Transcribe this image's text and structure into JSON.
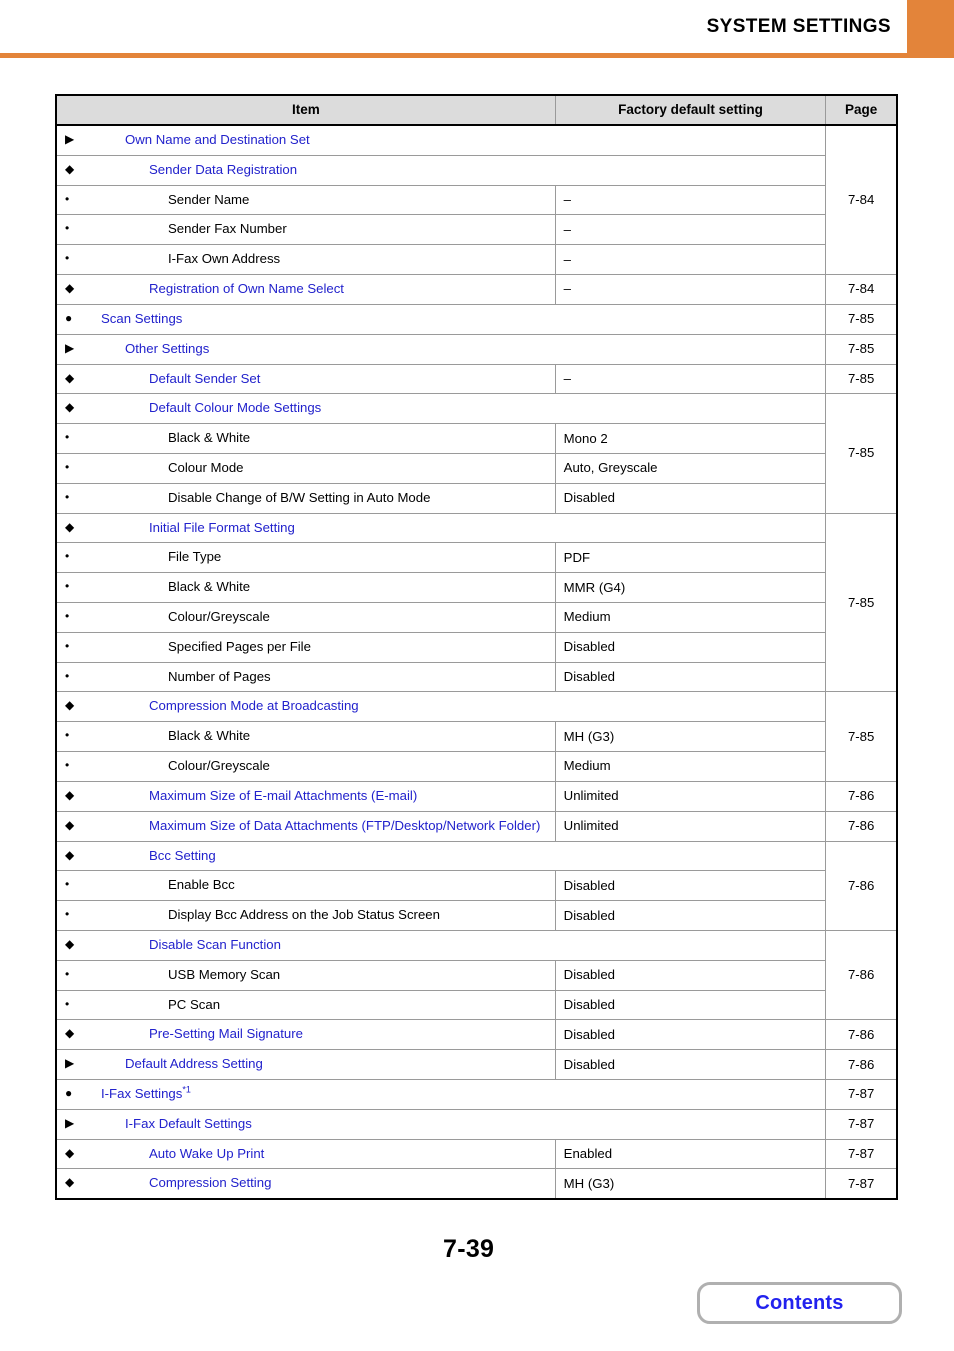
{
  "header": {
    "title": "SYSTEM SETTINGS",
    "accent_color": "#e3843a"
  },
  "table": {
    "columns": {
      "item": "Item",
      "factory_default": "Factory default setting",
      "page": "Page"
    },
    "link_color": "#2222cc",
    "rows": [
      {
        "level": 1,
        "bullet": "triangle",
        "label": "Own Name and Destination Set",
        "style": "link",
        "spans_default": true,
        "default": "",
        "page": "7-84",
        "page_rowspan": 5
      },
      {
        "level": 2,
        "bullet": "diamond",
        "label": "Sender Data Registration",
        "style": "link",
        "spans_default": true,
        "default": ""
      },
      {
        "level": 3,
        "bullet": "dot",
        "label": "Sender Name",
        "style": "plain",
        "default": "–"
      },
      {
        "level": 3,
        "bullet": "dot",
        "label": "Sender Fax Number",
        "style": "plain",
        "default": "–"
      },
      {
        "level": 3,
        "bullet": "dot",
        "label": "I-Fax Own Address",
        "style": "plain",
        "default": "–"
      },
      {
        "level": 2,
        "bullet": "diamond",
        "label": "Registration of Own Name Select",
        "style": "link",
        "default": "–",
        "page": "7-84",
        "page_rowspan": 1
      },
      {
        "level": 0,
        "bullet": "circle",
        "label": "Scan Settings",
        "style": "link",
        "spans_default": true,
        "default": "",
        "page": "7-85",
        "page_rowspan": 1
      },
      {
        "level": 1,
        "bullet": "triangle",
        "label": "Other Settings",
        "style": "link",
        "spans_default": true,
        "default": "",
        "page": "7-85",
        "page_rowspan": 1
      },
      {
        "level": 2,
        "bullet": "diamond",
        "label": "Default Sender Set",
        "style": "link",
        "default": "–",
        "page": "7-85",
        "page_rowspan": 1
      },
      {
        "level": 2,
        "bullet": "diamond",
        "label": "Default Colour Mode Settings",
        "style": "link",
        "spans_default": true,
        "default": "",
        "page": "7-85",
        "page_rowspan": 4
      },
      {
        "level": 3,
        "bullet": "dot",
        "label": "Black & White",
        "style": "plain",
        "default": "Mono 2"
      },
      {
        "level": 3,
        "bullet": "dot",
        "label": "Colour Mode",
        "style": "plain",
        "default": "Auto, Greyscale"
      },
      {
        "level": 3,
        "bullet": "dot",
        "label": "Disable Change of B/W Setting in Auto Mode",
        "style": "plain",
        "default": "Disabled"
      },
      {
        "level": 2,
        "bullet": "diamond",
        "label": "Initial File Format Setting",
        "style": "link",
        "spans_default": true,
        "default": "",
        "page": "7-85",
        "page_rowspan": 6
      },
      {
        "level": 3,
        "bullet": "dot",
        "label": "File Type",
        "style": "plain",
        "default": "PDF"
      },
      {
        "level": 3,
        "bullet": "dot",
        "label": "Black & White",
        "style": "plain",
        "default": "MMR (G4)"
      },
      {
        "level": 3,
        "bullet": "dot",
        "label": "Colour/Greyscale",
        "style": "plain",
        "default": "Medium"
      },
      {
        "level": 3,
        "bullet": "dot",
        "label": "Specified Pages per File",
        "style": "plain",
        "default": "Disabled"
      },
      {
        "level": 3,
        "bullet": "dot",
        "label": "Number of Pages",
        "style": "plain",
        "default": "Disabled"
      },
      {
        "level": 2,
        "bullet": "diamond",
        "label": "Compression Mode at Broadcasting",
        "style": "link",
        "spans_default": true,
        "default": "",
        "page": "7-85",
        "page_rowspan": 3
      },
      {
        "level": 3,
        "bullet": "dot",
        "label": "Black & White",
        "style": "plain",
        "default": "MH (G3)"
      },
      {
        "level": 3,
        "bullet": "dot",
        "label": "Colour/Greyscale",
        "style": "plain",
        "default": "Medium"
      },
      {
        "level": 2,
        "bullet": "diamond",
        "label": "Maximum Size of E-mail Attachments (E-mail)",
        "style": "link",
        "default": "Unlimited",
        "page": "7-86",
        "page_rowspan": 1
      },
      {
        "level": 2,
        "bullet": "diamond",
        "label": "Maximum Size of Data Attachments (FTP/Desktop/Network Folder)",
        "style": "link",
        "default": "Unlimited",
        "page": "7-86",
        "page_rowspan": 1
      },
      {
        "level": 2,
        "bullet": "diamond",
        "label": "Bcc Setting",
        "style": "link",
        "spans_default": true,
        "default": "",
        "page": "7-86",
        "page_rowspan": 3
      },
      {
        "level": 3,
        "bullet": "dot",
        "label": "Enable Bcc",
        "style": "plain",
        "default": "Disabled"
      },
      {
        "level": 3,
        "bullet": "dot",
        "label": "Display Bcc Address on the Job Status Screen",
        "style": "plain",
        "default": "Disabled"
      },
      {
        "level": 2,
        "bullet": "diamond",
        "label": "Disable Scan Function",
        "style": "link",
        "spans_default": true,
        "default": "",
        "page": "7-86",
        "page_rowspan": 3
      },
      {
        "level": 3,
        "bullet": "dot",
        "label": "USB Memory Scan",
        "style": "plain",
        "default": "Disabled"
      },
      {
        "level": 3,
        "bullet": "dot",
        "label": "PC Scan",
        "style": "plain",
        "default": "Disabled"
      },
      {
        "level": 2,
        "bullet": "diamond",
        "label": "Pre-Setting Mail Signature",
        "style": "link",
        "default": "Disabled",
        "page": "7-86",
        "page_rowspan": 1
      },
      {
        "level": 1,
        "bullet": "triangle",
        "label": "Default Address Setting",
        "style": "link",
        "default": "Disabled",
        "page": "7-86",
        "page_rowspan": 1
      },
      {
        "level": 0,
        "bullet": "circle",
        "label": "I-Fax Settings",
        "footnote": "*1",
        "style": "link",
        "spans_default": true,
        "default": "",
        "page": "7-87",
        "page_rowspan": 1
      },
      {
        "level": 1,
        "bullet": "triangle",
        "label": "I-Fax Default Settings",
        "style": "link",
        "spans_default": true,
        "default": "",
        "page": "7-87",
        "page_rowspan": 1
      },
      {
        "level": 2,
        "bullet": "diamond",
        "label": "Auto Wake Up Print",
        "style": "link",
        "default": "Enabled",
        "page": "7-87",
        "page_rowspan": 1
      },
      {
        "level": 2,
        "bullet": "diamond",
        "label": "Compression Setting",
        "style": "link",
        "default": "MH (G3)",
        "page": "7-87",
        "page_rowspan": 1
      }
    ]
  },
  "footer": {
    "page_number": "7-39",
    "contents_label": "Contents"
  }
}
